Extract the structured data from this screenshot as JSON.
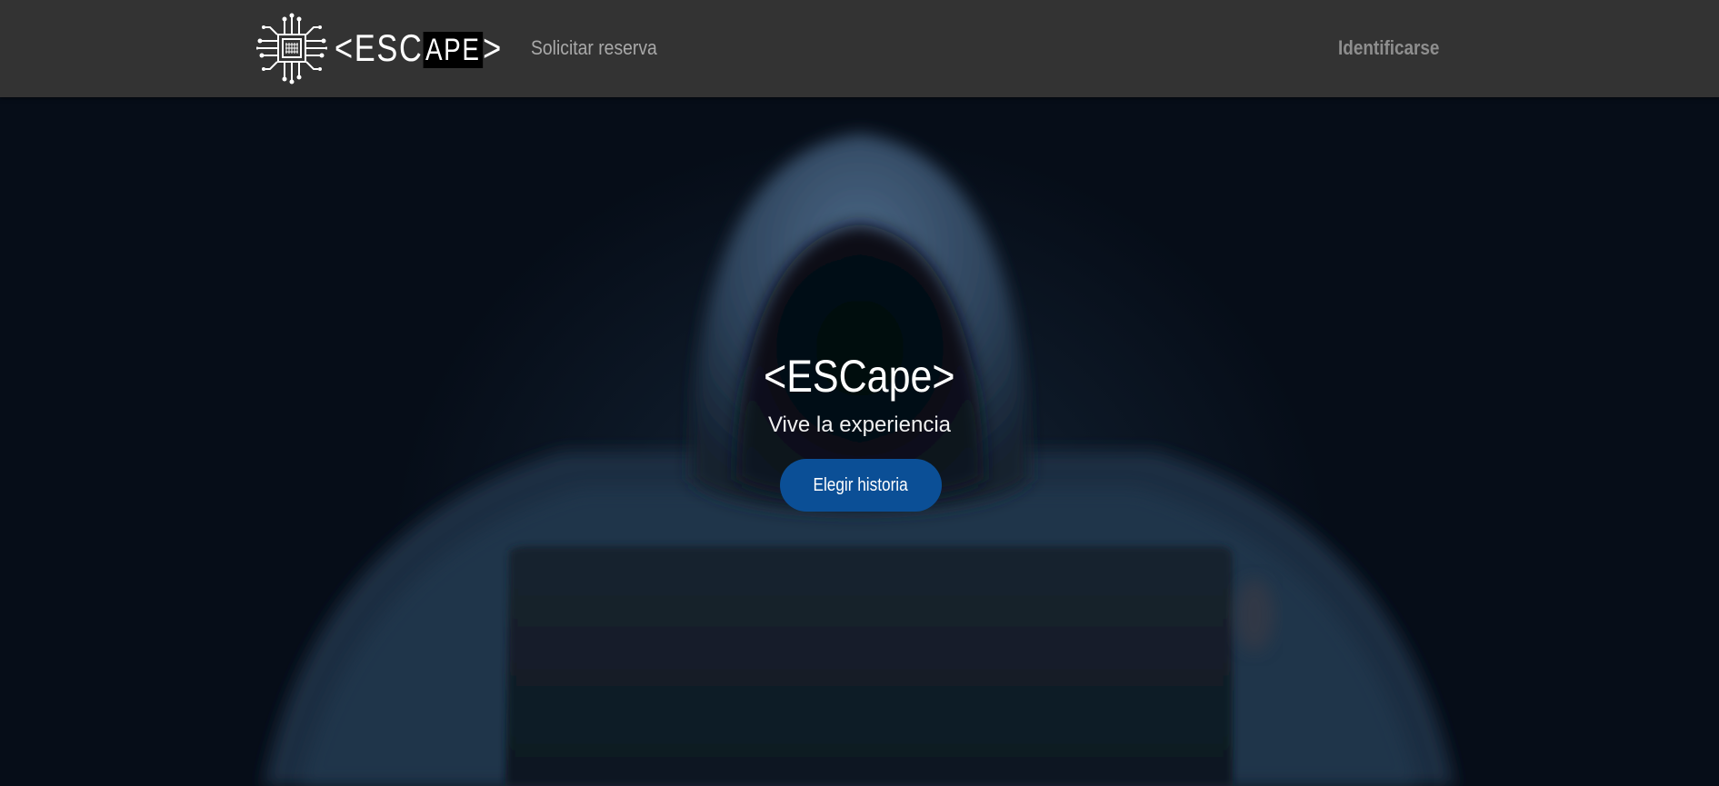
{
  "header": {
    "logo_prefix": "<ESC",
    "logo_highlight": "APE",
    "logo_suffix": ">",
    "nav_reserve": "Solicitar reserva",
    "login": "Identificarse"
  },
  "hero": {
    "title": "<ESCape>",
    "subtitle": "Vive la experiencia",
    "cta": "Elegir historia"
  },
  "colors": {
    "navbar": "#333333",
    "cta": "#0b4f96",
    "hero_bg": "#060d18"
  },
  "icons": [
    "circuit-chip-icon"
  ]
}
